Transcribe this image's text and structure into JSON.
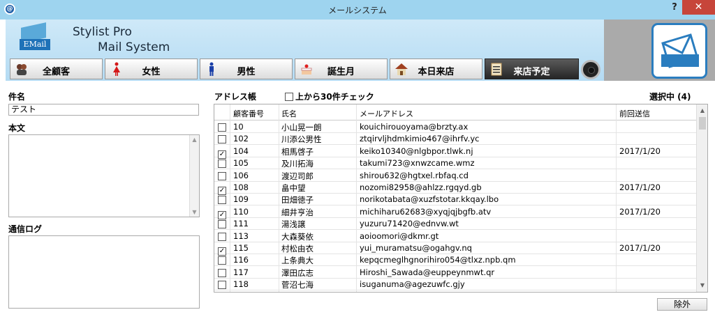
{
  "window": {
    "title": "メールシステム",
    "help": "?",
    "close": "✕",
    "app_icon": "@"
  },
  "brand": {
    "line1": "Stylist Pro",
    "line2": "Mail System",
    "logo_text": "EMail"
  },
  "tabs": [
    {
      "label": "全顧客",
      "icon": "group-icon"
    },
    {
      "label": "女性",
      "icon": "female-icon"
    },
    {
      "label": "男性",
      "icon": "male-icon"
    },
    {
      "label": "誕生月",
      "icon": "cake-icon"
    },
    {
      "label": "本日来店",
      "icon": "house-icon"
    },
    {
      "label": "来店予定",
      "icon": "clipboard-icon",
      "active": true
    }
  ],
  "form": {
    "subject_label": "件名",
    "subject_value": "テスト",
    "body_label": "本文",
    "log_label": "通信ログ"
  },
  "address_book": {
    "label": "アドレス帳",
    "top30_label": "上から30件チェック",
    "selected_label": "選択中 (4)",
    "columns": [
      "顧客番号",
      "氏名",
      "メールアドレス",
      "前回送信"
    ],
    "rows": [
      {
        "checked": false,
        "id": "10",
        "name": "小山晃一朗",
        "email": "kouichirouoyama@brzty.ax",
        "last": ""
      },
      {
        "checked": false,
        "id": "102",
        "name": "川添公男性",
        "email": "ztqirvljhdmkimio467@ihrfv.yc",
        "last": ""
      },
      {
        "checked": true,
        "id": "104",
        "name": "相馬啓子",
        "email": "keiko10340@nlgbpor.tlwk.nj",
        "last": "2017/1/20"
      },
      {
        "checked": false,
        "id": "105",
        "name": "及川拓海",
        "email": "takumi723@xnwzcame.wmz",
        "last": ""
      },
      {
        "checked": false,
        "id": "106",
        "name": "渡辺司郎",
        "email": "shirou632@hgtxel.rbfaq.cd",
        "last": ""
      },
      {
        "checked": true,
        "id": "108",
        "name": "畠中望",
        "email": "nozomi82958@ahlzz.rgqyd.gb",
        "last": "2017/1/20"
      },
      {
        "checked": false,
        "id": "109",
        "name": "田畑徳子",
        "email": "norikotabata@xuzfstotar.kkqay.lbo",
        "last": ""
      },
      {
        "checked": true,
        "id": "110",
        "name": "細井亨治",
        "email": "michiharu62683@xyqjqjbgfb.atv",
        "last": "2017/1/20"
      },
      {
        "checked": false,
        "id": "111",
        "name": "湯浅譲",
        "email": "yuzuru71420@ednvw.wt",
        "last": ""
      },
      {
        "checked": false,
        "id": "113",
        "name": "大森葵依",
        "email": "aoioomori@dkmr.gt",
        "last": ""
      },
      {
        "checked": true,
        "id": "115",
        "name": "村松由衣",
        "email": "yui_muramatsu@ogahgv.nq",
        "last": "2017/1/20"
      },
      {
        "checked": false,
        "id": "116",
        "name": "上条典大",
        "email": "kepqcmeglhgnorihiro054@tlxz.npb.qm",
        "last": ""
      },
      {
        "checked": false,
        "id": "117",
        "name": "澤田広志",
        "email": "Hiroshi_Sawada@euppeynmwt.qr",
        "last": ""
      },
      {
        "checked": false,
        "id": "118",
        "name": "菅沼七海",
        "email": "isuganuma@agezuwfc.gjy",
        "last": ""
      }
    ]
  },
  "exclude_button": "除外",
  "colors": {
    "titlebar": "#9ed4ef",
    "close": "#c7453a",
    "header": "#b4dbf3",
    "accent": "#2a7dbf"
  }
}
